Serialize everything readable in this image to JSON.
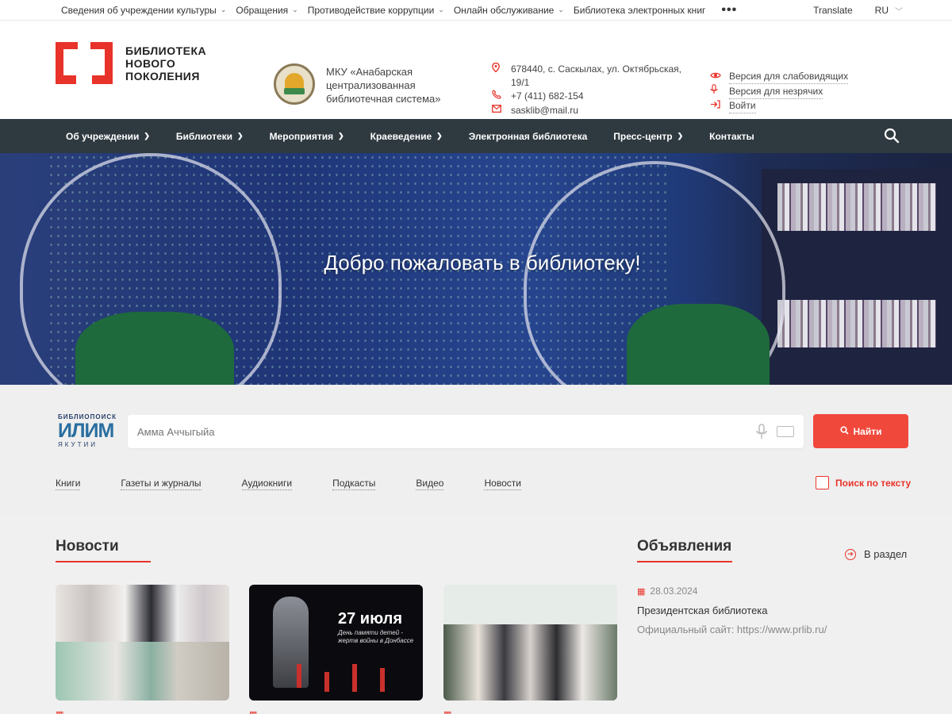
{
  "topbar": {
    "items": [
      {
        "label": "Сведения об учреждении культуры",
        "chevron": true
      },
      {
        "label": "Обращения",
        "chevron": true
      },
      {
        "label": "Противодействие коррупции",
        "chevron": true
      },
      {
        "label": "Онлайн обслуживание",
        "chevron": true
      },
      {
        "label": "Библиотека электронных книг",
        "chevron": false
      }
    ],
    "more": "•••",
    "translate": "Translate",
    "lang": "RU"
  },
  "header": {
    "logo_lines": [
      "БИБЛИОТЕКА",
      "НОВОГО",
      "ПОКОЛЕНИЯ"
    ],
    "org_name": "МКУ «Анабарская централизованная библиотечная система»",
    "address": "678440, с. Саскылах, ул. Октябрьская, 19/1",
    "phone": "+7 (411) 682-154",
    "email": "sasklib@mail.ru",
    "access_links": [
      "Версия для слабовидящих",
      "Версия для незрячих",
      "Войти"
    ]
  },
  "nav": {
    "items": [
      {
        "label": "Об учреждении",
        "chevron": true
      },
      {
        "label": "Библиотеки",
        "chevron": true
      },
      {
        "label": "Мероприятия",
        "chevron": true
      },
      {
        "label": "Краеведение",
        "chevron": true
      },
      {
        "label": "Электронная библиотека",
        "chevron": false
      },
      {
        "label": "Пресс-центр",
        "chevron": true
      },
      {
        "label": "Контакты",
        "chevron": false
      }
    ]
  },
  "hero": {
    "title": "Добро пожаловать в библиотеку!"
  },
  "search": {
    "brand_top": "БИБЛИОПОИСК",
    "brand_mid": "ИЛИМ",
    "brand_bottom": "ЯКУТИИ",
    "placeholder": "Амма Аччыгыйа",
    "button": "Найти",
    "categories": [
      "Книги",
      "Газеты и журналы",
      "Аудиокниги",
      "Подкасты",
      "Видео",
      "Новости"
    ],
    "text_search": "Поиск по тексту"
  },
  "news": {
    "title": "Новости",
    "card3_overlay_line1": "27 июля",
    "card3_overlay_line2": "День памяти детей -",
    "card3_overlay_line3": "жертв войны в Донбассе"
  },
  "announcements": {
    "title": "Объявления",
    "to_section": "В раздел",
    "date": "28.03.2024",
    "item_title": "Президентская библиотека",
    "item_body": "Официальный сайт: https://www.prlib.ru/"
  },
  "colors": {
    "accent": "#e8332a",
    "nav_bg": "#2f3a40",
    "button": "#f0483b"
  }
}
